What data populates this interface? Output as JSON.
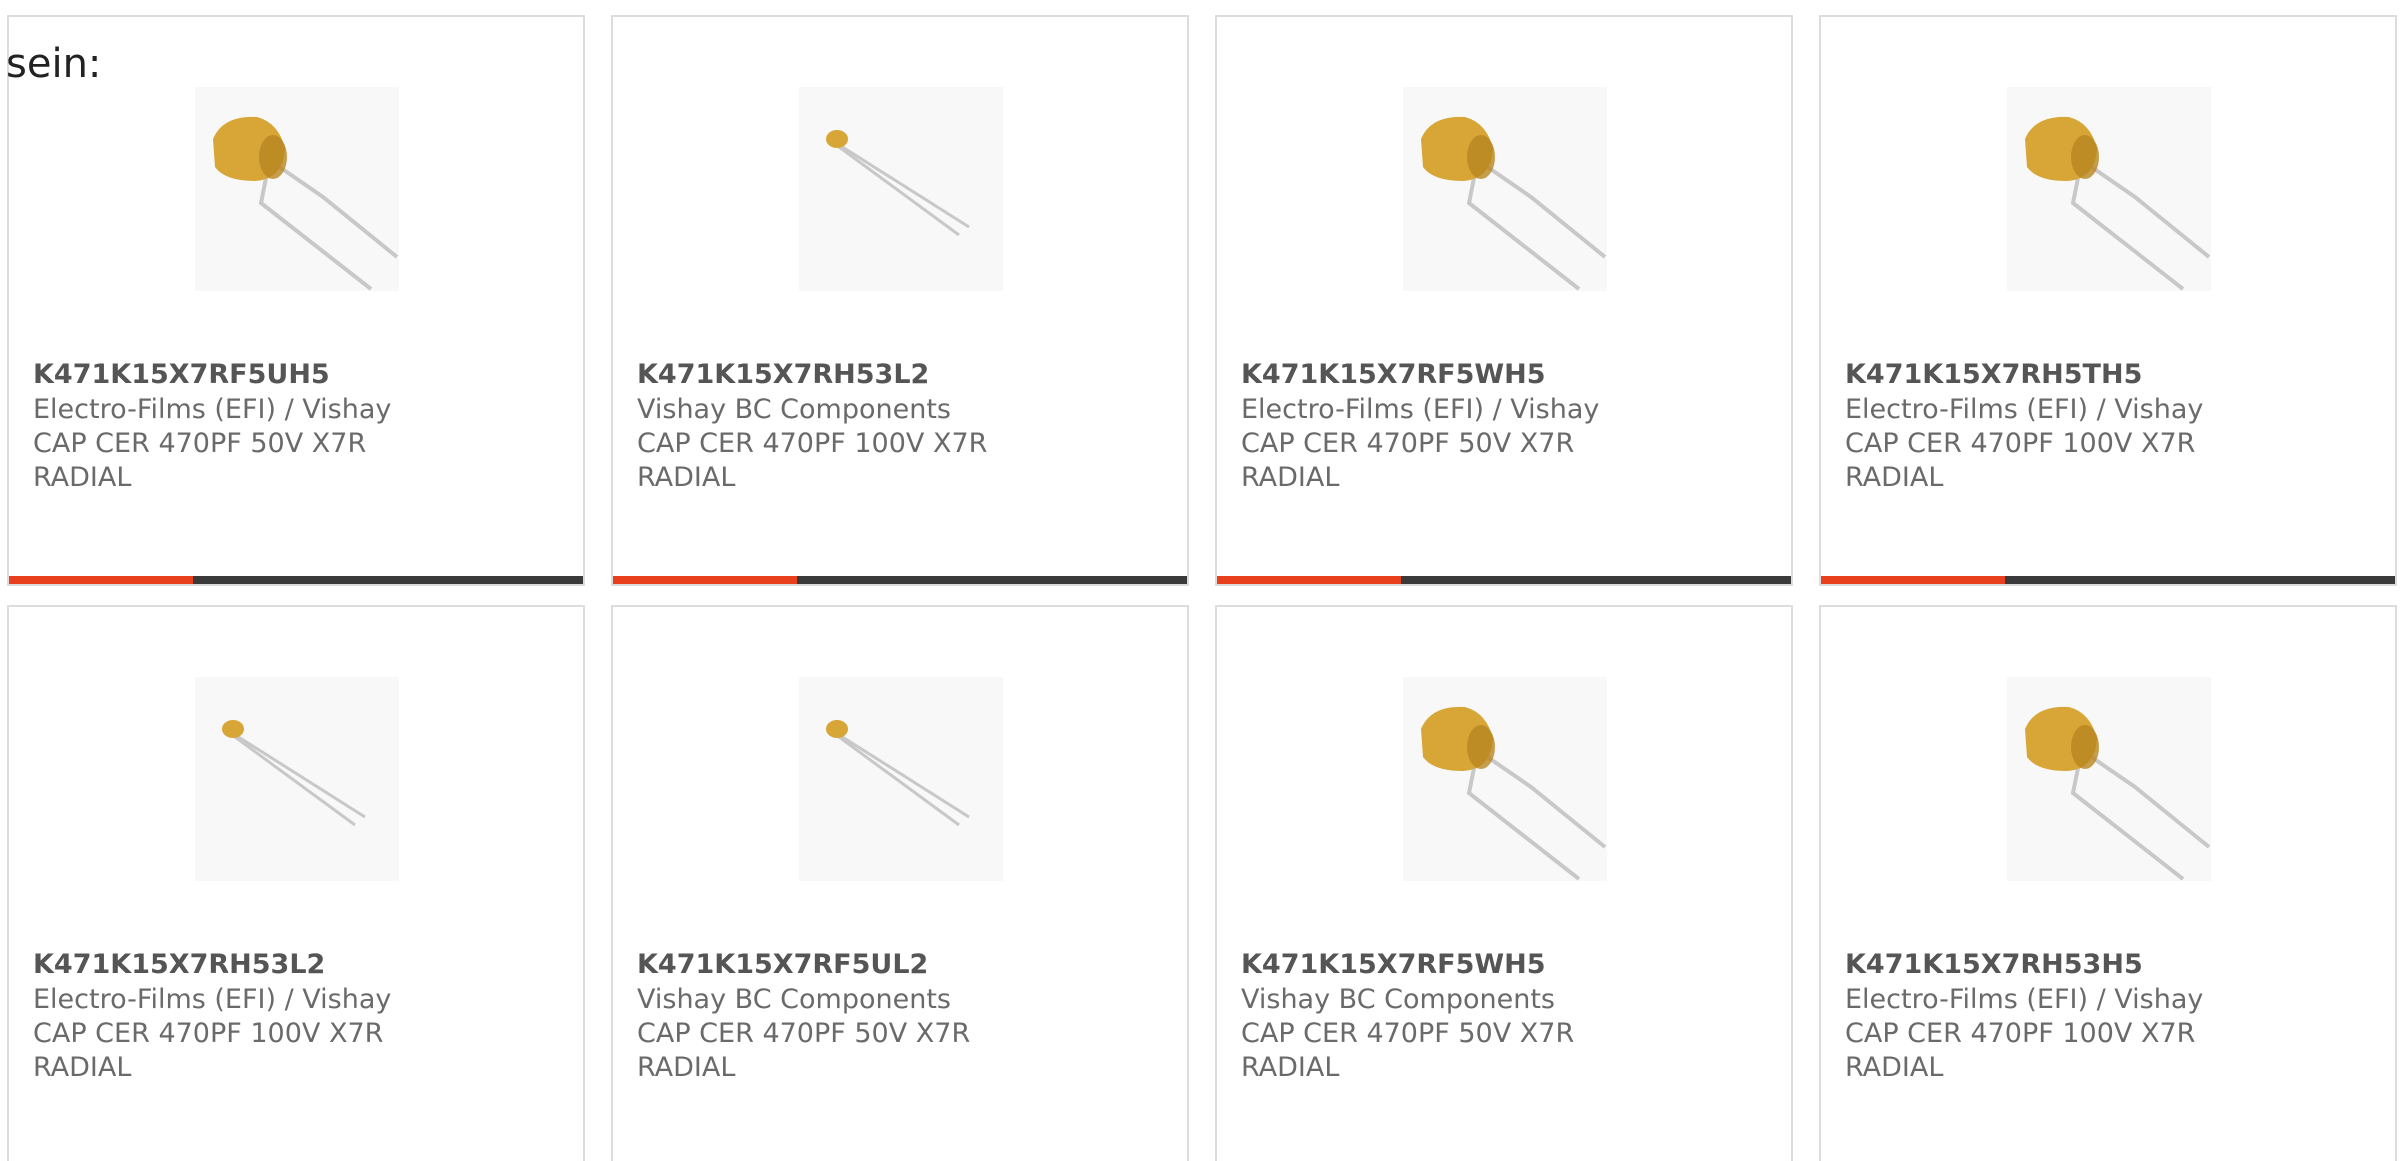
{
  "intro_text": "sein:",
  "colors": {
    "accent": "#e8401c",
    "track": "#3a3a3a",
    "border": "#dcdcdc",
    "capacitor_body": "#d8a637",
    "lead": "#c8c8c8"
  },
  "cards": [
    {
      "part_number": "K471K15X7RF5UH5",
      "manufacturer": "Electro-Films (EFI) / Vishay",
      "description": "CAP CER 470PF 50V X7R RADIAL",
      "image_icon": "capacitor-large-image",
      "progress_fraction": 0.32
    },
    {
      "part_number": "K471K15X7RH53L2",
      "manufacturer": "Vishay BC Components",
      "description": "CAP CER 470PF 100V X7R RADIAL",
      "image_icon": "capacitor-small-image",
      "progress_fraction": 0.32
    },
    {
      "part_number": "K471K15X7RF5WH5",
      "manufacturer": "Electro-Films (EFI) / Vishay",
      "description": "CAP CER 470PF 50V X7R RADIAL",
      "image_icon": "capacitor-large-image",
      "progress_fraction": 0.32
    },
    {
      "part_number": "K471K15X7RH5TH5",
      "manufacturer": "Electro-Films (EFI) / Vishay",
      "description": "CAP CER 470PF 100V X7R RADIAL",
      "image_icon": "capacitor-large-image",
      "progress_fraction": 0.32
    },
    {
      "part_number": "K471K15X7RH53L2",
      "manufacturer": "Electro-Films (EFI) / Vishay",
      "description": "CAP CER 470PF 100V X7R RADIAL",
      "image_icon": "capacitor-small-image",
      "progress_fraction": null
    },
    {
      "part_number": "K471K15X7RF5UL2",
      "manufacturer": "Vishay BC Components",
      "description": "CAP CER 470PF 50V X7R RADIAL",
      "image_icon": "capacitor-small-image",
      "progress_fraction": null
    },
    {
      "part_number": "K471K15X7RF5WH5",
      "manufacturer": "Vishay BC Components",
      "description": "CAP CER 470PF 50V X7R RADIAL",
      "image_icon": "capacitor-large-image",
      "progress_fraction": null
    },
    {
      "part_number": "K471K15X7RH53H5",
      "manufacturer": "Electro-Films (EFI) / Vishay",
      "description": "CAP CER 470PF 100V X7R RADIAL",
      "image_icon": "capacitor-large-image",
      "progress_fraction": null
    }
  ]
}
